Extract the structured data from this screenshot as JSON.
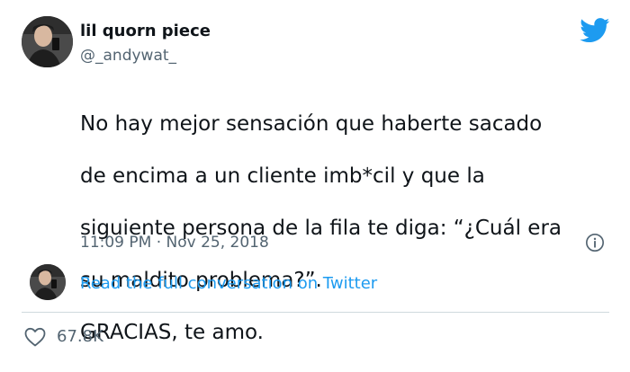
{
  "user": {
    "display_name": "lil quorn piece",
    "handle": "@_andywat_"
  },
  "tweet": {
    "text_lines": [
      "No hay mejor sensación que haberte sacado",
      "de encima a un cliente imb*cil y que la",
      "siguiente persona de la fila te diga: “¿Cuál era",
      "su maldito problema?”.",
      "GRACIAS, te amo."
    ],
    "timestamp": "11:09 PM · Nov 25, 2018"
  },
  "links": {
    "read_conversation": "Read the full conversation on Twitter"
  },
  "engagement": {
    "likes": "67.8K"
  },
  "icons": {
    "brand": "twitter-bird-icon",
    "info": "info-icon",
    "like": "heart-icon"
  },
  "colors": {
    "brand_blue": "#1d9bf0",
    "secondary_text": "#536471",
    "primary_text": "#0f1419",
    "divider": "#cfd9de"
  }
}
